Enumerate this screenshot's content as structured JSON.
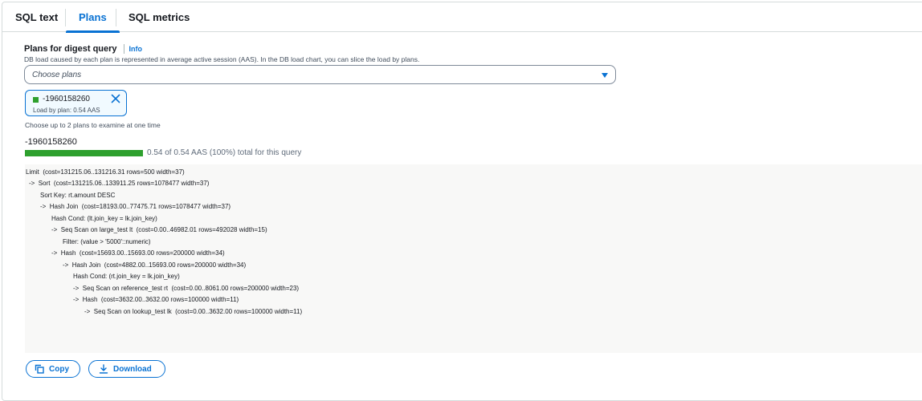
{
  "tabs": [
    {
      "label": "SQL text",
      "active": false
    },
    {
      "label": "Plans",
      "active": true
    },
    {
      "label": "SQL metrics",
      "active": false
    }
  ],
  "section": {
    "title": "Plans for digest query",
    "info_link": "Info",
    "description": "DB load caused by each plan is represented in average active session (AAS). In the DB load chart, you can slice the load by plans."
  },
  "select": {
    "placeholder": "Choose plans"
  },
  "token": {
    "name": "-1960158260",
    "load_label": "Load by plan: 0.54 AAS",
    "color": "#2ea02e"
  },
  "hint": "Choose up to 2 plans to examine at one time",
  "plan": {
    "id": "-1960158260",
    "share_fraction": 1.0,
    "summary": "0.54 of 0.54 AAS (100%) total for this query"
  },
  "plan_lines": [
    "Limit  (cost=131215.06..131216.31 rows=500 width=37)",
    "->  Sort  (cost=131215.06..133911.25 rows=1078477 width=37)",
    "Sort Key: rt.amount DESC",
    "->  Hash Join  (cost=18193.00..77475.71 rows=1078477 width=37)",
    "Hash Cond: (lt.join_key = lk.join_key)",
    "->  Seq Scan on large_test lt  (cost=0.00..46982.01 rows=492028 width=15)",
    "Filter: (value > '5000'::numeric)",
    "->  Hash  (cost=15693.00..15693.00 rows=200000 width=34)",
    "->  Hash Join  (cost=4882.00..15693.00 rows=200000 width=34)",
    "Hash Cond: (rt.join_key = lk.join_key)",
    "->  Seq Scan on reference_test rt  (cost=0.00..8061.00 rows=200000 width=23)",
    "->  Hash  (cost=3632.00..3632.00 rows=100000 width=11)",
    "->  Seq Scan on lookup_test lk  (cost=0.00..3632.00 rows=100000 width=11)"
  ],
  "buttons": {
    "copy": "Copy",
    "download": "Download"
  },
  "colors": {
    "accent": "#0972d3",
    "plan_green": "#2ea02e"
  }
}
